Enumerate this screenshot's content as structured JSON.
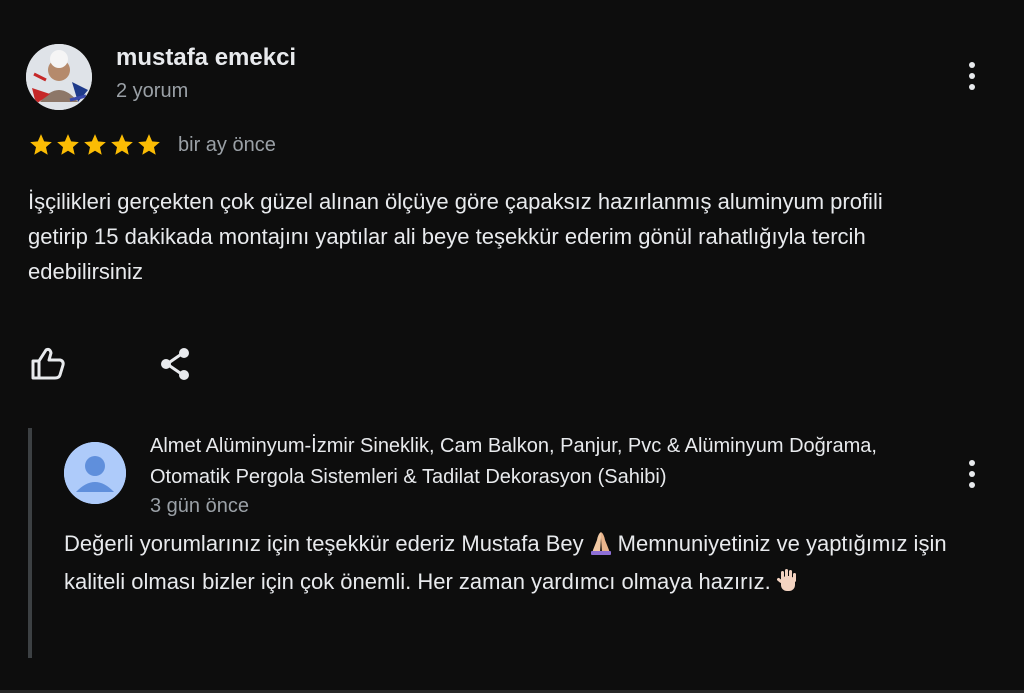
{
  "review": {
    "reviewer_name": "mustafa emekci",
    "review_count": "2 yorum",
    "rating": 5,
    "rating_max": 5,
    "date": "bir ay önce",
    "text": "İşçilikleri gerçekten çok güzel alınan ölçüye göre çapaksız hazırlanmış aluminyum profili getirip 15 dakikada montajını yaptılar ali beye teşekkür ederim gönül rahatlığıyla tercih edebilirsiniz"
  },
  "reply": {
    "owner_name": "Almet Alüminyum-İzmir Sineklik, Cam Balkon, Panjur, Pvc & Alüminyum Doğrama, Otomatik Pergola Sistemleri & Tadilat Dekorasyon (Sahibi)",
    "date": "3 gün önce",
    "text_part1": "Değerli yorumlarınız için teşekkür ederiz Mustafa Bey",
    "emoji1": "folded-hands",
    "text_part2": "Memnuniyetiniz ve yaptığımız işin kaliteli olması bizler için çok önemli. Her zaman yardımcı olmaya hazırız.",
    "emoji2": "raised-hand"
  },
  "icons": {
    "like": "thumbs-up-icon",
    "share": "share-icon",
    "more": "more-vert-icon",
    "star": "star-icon"
  },
  "colors": {
    "background": "#0d0d0d",
    "star": "#fbbc04",
    "text_primary": "#e8eaed",
    "text_secondary": "#9aa0a6",
    "reply_bar": "#3c4043",
    "owner_avatar_bg": "#aecbfa",
    "owner_avatar_fg": "#5f8fdc"
  }
}
